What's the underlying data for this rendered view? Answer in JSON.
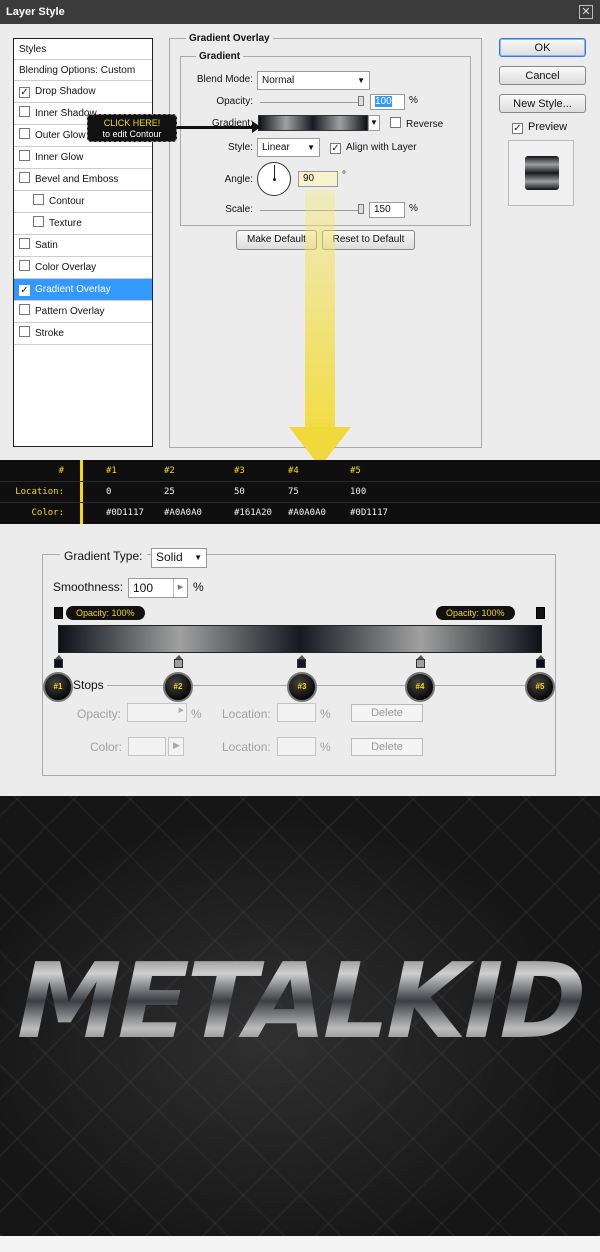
{
  "dialog": {
    "title": "Layer Style",
    "close_icon": "close-icon",
    "styles_list": [
      {
        "label": "Styles",
        "type": "header"
      },
      {
        "label": "Blending Options: Custom",
        "type": "header"
      },
      {
        "label": "Drop Shadow",
        "checked": true
      },
      {
        "label": "Inner Shadow",
        "checked": false
      },
      {
        "label": "Outer Glow",
        "checked": false
      },
      {
        "label": "Inner Glow",
        "checked": false
      },
      {
        "label": "Bevel and Emboss",
        "checked": false
      },
      {
        "label": "Contour",
        "checked": false,
        "sub": true
      },
      {
        "label": "Texture",
        "checked": false,
        "sub": true
      },
      {
        "label": "Satin",
        "checked": false
      },
      {
        "label": "Color Overlay",
        "checked": false
      },
      {
        "label": "Gradient Overlay",
        "checked": true,
        "selected": true
      },
      {
        "label": "Pattern Overlay",
        "checked": false
      },
      {
        "label": "Stroke",
        "checked": false
      }
    ],
    "section_title": "Gradient Overlay",
    "subsection_title": "Gradient",
    "blend_mode": {
      "label": "Blend Mode:",
      "value": "Normal"
    },
    "opacity": {
      "label": "Opacity:",
      "value": "100",
      "unit": "%",
      "level": 1.0
    },
    "gradient": {
      "label": "Gradient:",
      "reverse_label": "Reverse",
      "reverse_checked": false
    },
    "style": {
      "label": "Style:",
      "value": "Linear",
      "align_label": "Align with Layer",
      "align_checked": true
    },
    "angle": {
      "label": "Angle:",
      "value": "90",
      "unit": "°"
    },
    "scale": {
      "label": "Scale:",
      "value": "150",
      "unit": "%",
      "level": 1.0
    },
    "make_default": "Make Default",
    "reset_default": "Reset to Default",
    "ok": "OK",
    "cancel": "Cancel",
    "new_style": "New Style...",
    "preview": {
      "label": "Preview",
      "checked": true
    },
    "tooltip": {
      "line1": "CLICK HERE!",
      "line2": "to edit Contour"
    },
    "accent_color": "#3399ff",
    "highlight_color": "#f5d90a"
  },
  "strip": {
    "header": {
      "key": "#",
      "values": [
        "#1",
        "#2",
        "#3",
        "#4",
        "#5"
      ]
    },
    "location": {
      "key": "Location:",
      "values": [
        "0",
        "25",
        "50",
        "75",
        "100"
      ]
    },
    "color": {
      "key": "Color:",
      "values": [
        "#0D1117",
        "#A0A0A0",
        "#161A20",
        "#A0A0A0",
        "#0D1117"
      ]
    }
  },
  "editor": {
    "gradient_type": {
      "label": "Gradient Type:",
      "value": "Solid"
    },
    "smoothness": {
      "label": "Smoothness:",
      "value": "100",
      "unit": "%"
    },
    "opacity_left": "Opacity: 100%",
    "opacity_right": "Opacity: 100%",
    "stops_label": "Stops",
    "markers": [
      "#1",
      "#2",
      "#3",
      "#4",
      "#5"
    ],
    "stop_opacity": {
      "label": "Opacity:",
      "unit": "%",
      "location_label": "Location:",
      "location_unit": "%",
      "delete": "Delete"
    },
    "stop_color": {
      "label": "Color:",
      "location_label": "Location:",
      "location_unit": "%",
      "delete": "Delete"
    }
  },
  "artwork": {
    "text": "METALKID"
  }
}
